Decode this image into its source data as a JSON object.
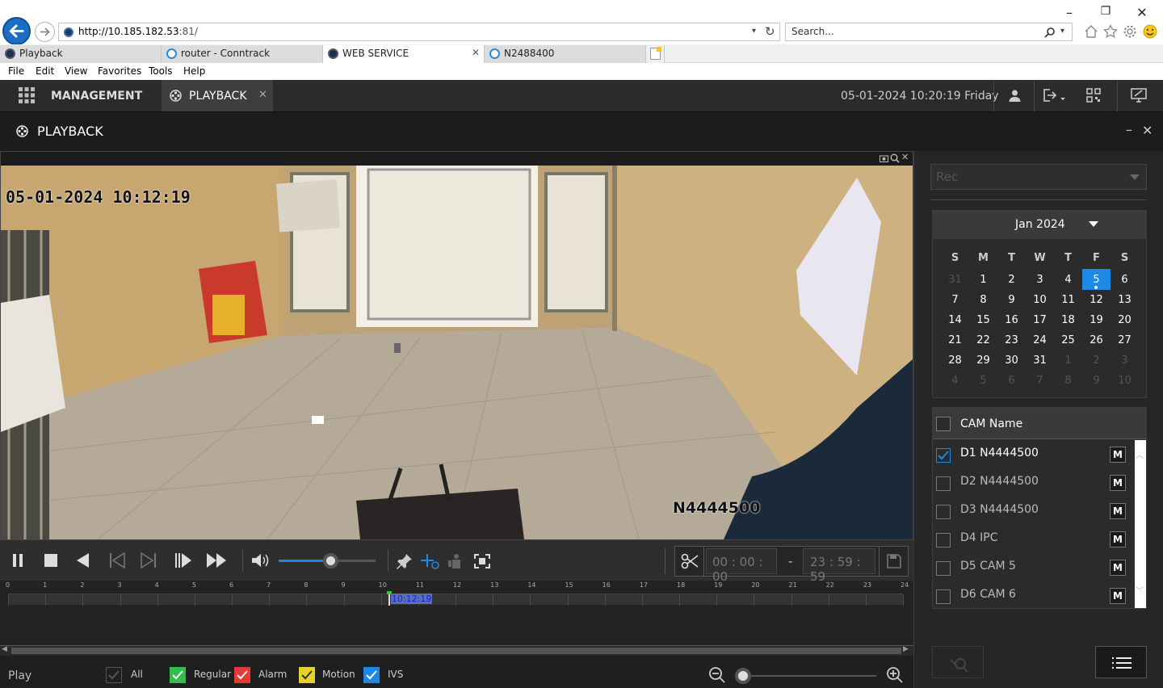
{
  "browser": {
    "address_url_host": "http://10.185.182.53",
    "address_url_rest": ":81/",
    "search_placeholder": "Search...",
    "tabs": [
      {
        "label": "Playback"
      },
      {
        "label": "router - Conntrack"
      },
      {
        "label": "WEB SERVICE"
      },
      {
        "label": "N2488400"
      }
    ],
    "menu": [
      "File",
      "Edit",
      "View",
      "Favorites",
      "Tools",
      "Help"
    ]
  },
  "app": {
    "management_label": "MANAGEMENT",
    "playback_tab_label": "PLAYBACK",
    "datetime": "05-01-2024 10:20:19 Friday",
    "panel_title": "PLAYBACK"
  },
  "video": {
    "osd_timestamp": "05-01-2024 10:12:19",
    "osd_camera_name": "N4444500"
  },
  "controls": {
    "volume_level": 0.53,
    "clip_start": "00 : 00 : 00",
    "clip_separator": "-",
    "clip_end": "23 : 59 : 59"
  },
  "timeline": {
    "hours": [
      "0",
      "1",
      "2",
      "3",
      "4",
      "5",
      "6",
      "7",
      "8",
      "9",
      "10",
      "11",
      "12",
      "13",
      "14",
      "15",
      "16",
      "17",
      "18",
      "19",
      "20",
      "21",
      "22",
      "23",
      "24"
    ],
    "cursor_time": "10:12:19",
    "cursor_hour": 10.2
  },
  "bottom": {
    "status": "Play",
    "legend": [
      {
        "label": "All",
        "color": "#3a3a3a"
      },
      {
        "label": "Regular",
        "color": "#2fbf4a"
      },
      {
        "label": "Alarm",
        "color": "#e53935"
      },
      {
        "label": "Motion",
        "color": "#e8d12a"
      },
      {
        "label": "IVS",
        "color": "#1e88e5"
      }
    ]
  },
  "sidebar": {
    "record_type_placeholder": "Rec",
    "calendar": {
      "month": "Jan 2024",
      "weekdays": [
        "S",
        "M",
        "T",
        "W",
        "T",
        "F",
        "S"
      ],
      "weeks": [
        [
          "31",
          "1",
          "2",
          "3",
          "4",
          "5",
          "6"
        ],
        [
          "7",
          "8",
          "9",
          "10",
          "11",
          "12",
          "13"
        ],
        [
          "14",
          "15",
          "16",
          "17",
          "18",
          "19",
          "20"
        ],
        [
          "21",
          "22",
          "23",
          "24",
          "25",
          "26",
          "27"
        ],
        [
          "28",
          "29",
          "30",
          "31",
          "1",
          "2",
          "3"
        ],
        [
          "4",
          "5",
          "6",
          "7",
          "8",
          "9",
          "10"
        ]
      ],
      "selected": "5"
    },
    "cam_header": "CAM Name",
    "cameras": [
      {
        "name": "D1 N4444500",
        "checked": true
      },
      {
        "name": "D2 N4444500",
        "checked": false
      },
      {
        "name": "D3 N4444500",
        "checked": false
      },
      {
        "name": "D4 IPC",
        "checked": false
      },
      {
        "name": "D5 CAM 5",
        "checked": false
      },
      {
        "name": "D6 CAM 6",
        "checked": false
      }
    ],
    "m_label": "M"
  }
}
